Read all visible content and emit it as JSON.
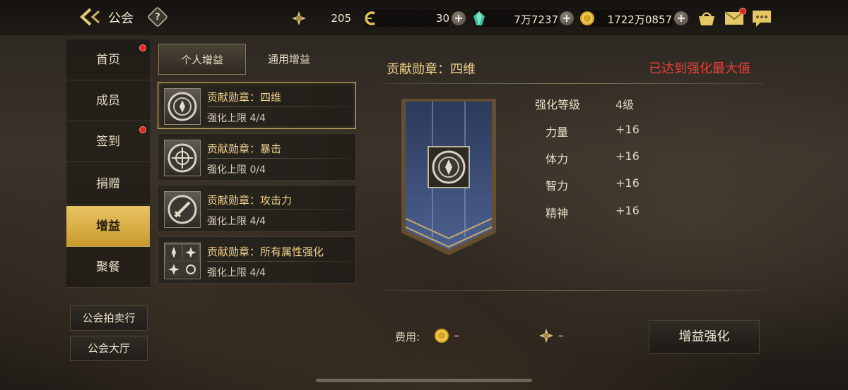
{
  "header": {
    "title": "公会",
    "help_label": "?",
    "resources": [
      {
        "icon": "energy-star-icon",
        "value": "205"
      },
      {
        "icon": "c-coin-icon",
        "value": "30"
      },
      {
        "icon": "green-gem-icon",
        "value": "7万7237"
      },
      {
        "icon": "gold-coin-icon",
        "value": "1722万0857"
      }
    ]
  },
  "sidebar": {
    "items": [
      {
        "label": "首页",
        "badge": true
      },
      {
        "label": "成员",
        "badge": false
      },
      {
        "label": "签到",
        "badge": true
      },
      {
        "label": "捐赠",
        "badge": false
      },
      {
        "label": "增益",
        "badge": false,
        "active": true
      },
      {
        "label": "聚餐",
        "badge": false
      }
    ],
    "buttons": [
      "公会拍卖行",
      "公会大厅"
    ]
  },
  "tabs": [
    {
      "label": "个人增益",
      "active": true
    },
    {
      "label": "通用增益",
      "active": false
    }
  ],
  "buffs": [
    {
      "name": "贡献勋章：四维",
      "limit": "强化上限 4/4",
      "active": true
    },
    {
      "name": "贡献勋章：暴击",
      "limit": "强化上限 0/4",
      "active": false
    },
    {
      "name": "贡献勋章：攻击力",
      "limit": "强化上限 4/4",
      "active": false
    },
    {
      "name": "贡献勋章：所有属性强化",
      "limit": "强化上限 4/4",
      "active": false
    }
  ],
  "detail": {
    "title": "贡献勋章：四维",
    "status": "已达到强化最大值",
    "stats": [
      {
        "label": "强化等级",
        "value": "4级"
      },
      {
        "label": "力量",
        "value": "+16"
      },
      {
        "label": "体力",
        "value": "+16"
      },
      {
        "label": "智力",
        "value": "+16"
      },
      {
        "label": "精神",
        "value": "+16"
      }
    ],
    "cost_label": "费用:",
    "cost_gold": "–",
    "cost_star": "–",
    "enhance_button": "增益强化"
  },
  "colors": {
    "accent_gold": "#e9c562",
    "title_gold": "#f1d28a",
    "alert_red": "#e8413a",
    "badge_red": "#e02a1c"
  }
}
